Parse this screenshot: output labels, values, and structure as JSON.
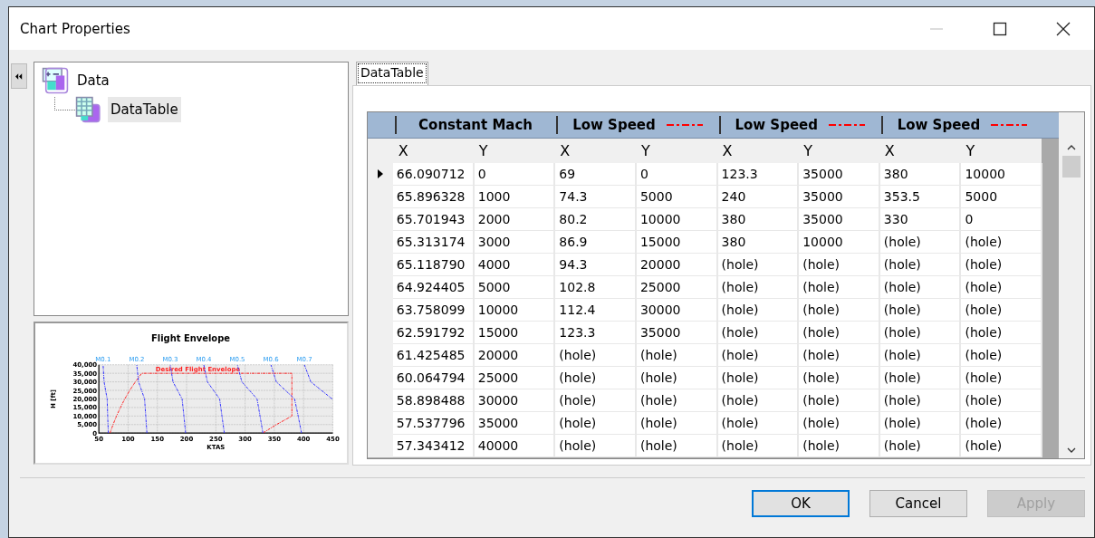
{
  "window": {
    "title": "Chart Properties"
  },
  "tree": [
    {
      "label": "Data",
      "kind": "data",
      "selected": false,
      "children": [
        {
          "label": "DataTable",
          "kind": "table",
          "selected": true
        }
      ]
    }
  ],
  "preview": {
    "chart_data": {
      "type": "line",
      "title": "Flight Envelope",
      "xlabel": "KTAS",
      "ylabel": "H [ft]",
      "xlim": [
        50,
        450
      ],
      "ylim": [
        0,
        40000
      ],
      "xticks": [
        50,
        100,
        150,
        200,
        250,
        300,
        350,
        400,
        450
      ],
      "yticks": [
        {
          "value": 0,
          "label": "0"
        },
        {
          "value": 5000,
          "label": "5,000"
        },
        {
          "value": 10000,
          "label": "10,000"
        },
        {
          "value": 15000,
          "label": "15,000"
        },
        {
          "value": 20000,
          "label": "20,000"
        },
        {
          "value": 25000,
          "label": "25,000"
        },
        {
          "value": 30000,
          "label": "30,000"
        },
        {
          "value": 35000,
          "label": "35,000"
        },
        {
          "value": 40000,
          "label": "40,000"
        }
      ],
      "series": [
        {
          "name": "Desired Flight Envelope",
          "color": "#ff2020",
          "line_style": "dashdot",
          "x": [
            69,
            74.3,
            80.2,
            86.9,
            94.3,
            102.8,
            112.4,
            123.3,
            240,
            380,
            380,
            353.5,
            330
          ],
          "values": [
            0,
            5000,
            10000,
            15000,
            20000,
            25000,
            30000,
            35000,
            35000,
            35000,
            10000,
            5000,
            0
          ]
        },
        {
          "name": "M0.1",
          "color": "#3030ff",
          "line_style": "dashdot",
          "x": [
            66.1,
            65.1,
            64.1,
            58.9,
            57.3
          ],
          "values": [
            0,
            10000,
            20000,
            30000,
            40000
          ]
        },
        {
          "name": "M0.2",
          "color": "#3030ff",
          "line_style": "dashdot",
          "x": [
            132.2,
            130.2,
            128.2,
            117.8,
            114.7
          ],
          "values": [
            0,
            10000,
            20000,
            30000,
            40000
          ]
        },
        {
          "name": "M0.3",
          "color": "#3030ff",
          "line_style": "dashdot",
          "x": [
            198.3,
            195.4,
            192.3,
            176.7,
            172
          ],
          "values": [
            0,
            10000,
            20000,
            30000,
            40000
          ]
        },
        {
          "name": "M0.4",
          "color": "#3030ff",
          "line_style": "dashdot",
          "x": [
            264.4,
            260.5,
            256.4,
            235.6,
            229.4
          ],
          "values": [
            0,
            10000,
            20000,
            30000,
            40000
          ]
        },
        {
          "name": "M0.5",
          "color": "#3030ff",
          "line_style": "dashdot",
          "x": [
            330.5,
            325.6,
            320.5,
            294.5,
            286.7
          ],
          "values": [
            0,
            10000,
            20000,
            30000,
            40000
          ]
        },
        {
          "name": "M0.6",
          "color": "#3030ff",
          "line_style": "dashdot",
          "x": [
            396.5,
            390.7,
            384.6,
            353.4,
            344.1
          ],
          "values": [
            0,
            10000,
            20000,
            30000,
            40000
          ]
        },
        {
          "name": "M0.7",
          "color": "#3030ff",
          "line_style": "dashdot",
          "x": [
            448.7,
            412.3,
            401.4
          ],
          "values": [
            20000,
            30000,
            40000
          ]
        }
      ],
      "grid": true
    }
  },
  "tabs": [
    {
      "label": "DataTable",
      "selected": true
    }
  ],
  "table": {
    "groups": [
      {
        "label": "Constant Mach"
      },
      {
        "label": "Low Speed",
        "color": "#ff0000"
      },
      {
        "label": "Low Speed",
        "color": "#ff0000"
      },
      {
        "label": "Low Speed",
        "color": "#ff0000"
      }
    ],
    "columns": [
      "X",
      "Y",
      "X",
      "Y",
      "X",
      "Y",
      "X",
      "Y"
    ],
    "rows": [
      {
        "selected": true,
        "cells": [
          "66.090712",
          "0",
          "69",
          "0",
          "123.3",
          "35000",
          "380",
          "10000"
        ]
      },
      {
        "selected": false,
        "cells": [
          "65.896328",
          "1000",
          "74.3",
          "5000",
          "240",
          "35000",
          "353.5",
          "5000"
        ]
      },
      {
        "selected": false,
        "cells": [
          "65.701943",
          "2000",
          "80.2",
          "10000",
          "380",
          "35000",
          "330",
          "0"
        ]
      },
      {
        "selected": false,
        "cells": [
          "65.313174",
          "3000",
          "86.9",
          "15000",
          "380",
          "10000",
          "(hole)",
          "(hole)"
        ]
      },
      {
        "selected": false,
        "cells": [
          "65.118790",
          "4000",
          "94.3",
          "20000",
          "(hole)",
          "(hole)",
          "(hole)",
          "(hole)"
        ]
      },
      {
        "selected": false,
        "cells": [
          "64.924405",
          "5000",
          "102.8",
          "25000",
          "(hole)",
          "(hole)",
          "(hole)",
          "(hole)"
        ]
      },
      {
        "selected": false,
        "cells": [
          "63.758099",
          "10000",
          "112.4",
          "30000",
          "(hole)",
          "(hole)",
          "(hole)",
          "(hole)"
        ]
      },
      {
        "selected": false,
        "cells": [
          "62.591792",
          "15000",
          "123.3",
          "35000",
          "(hole)",
          "(hole)",
          "(hole)",
          "(hole)"
        ]
      },
      {
        "selected": false,
        "cells": [
          "61.425485",
          "20000",
          "(hole)",
          "(hole)",
          "(hole)",
          "(hole)",
          "(hole)",
          "(hole)"
        ]
      },
      {
        "selected": false,
        "cells": [
          "60.064794",
          "25000",
          "(hole)",
          "(hole)",
          "(hole)",
          "(hole)",
          "(hole)",
          "(hole)"
        ]
      },
      {
        "selected": false,
        "cells": [
          "58.898488",
          "30000",
          "(hole)",
          "(hole)",
          "(hole)",
          "(hole)",
          "(hole)",
          "(hole)"
        ]
      },
      {
        "selected": false,
        "cells": [
          "57.537796",
          "35000",
          "(hole)",
          "(hole)",
          "(hole)",
          "(hole)",
          "(hole)",
          "(hole)"
        ]
      },
      {
        "selected": false,
        "cells": [
          "57.343412",
          "40000",
          "(hole)",
          "(hole)",
          "(hole)",
          "(hole)",
          "(hole)",
          "(hole)"
        ]
      }
    ]
  },
  "buttons": [
    {
      "label": "OK",
      "kind": "default",
      "disabled": false
    },
    {
      "label": "Cancel",
      "kind": "normal",
      "disabled": false
    },
    {
      "label": "Apply",
      "kind": "normal",
      "disabled": true
    }
  ]
}
